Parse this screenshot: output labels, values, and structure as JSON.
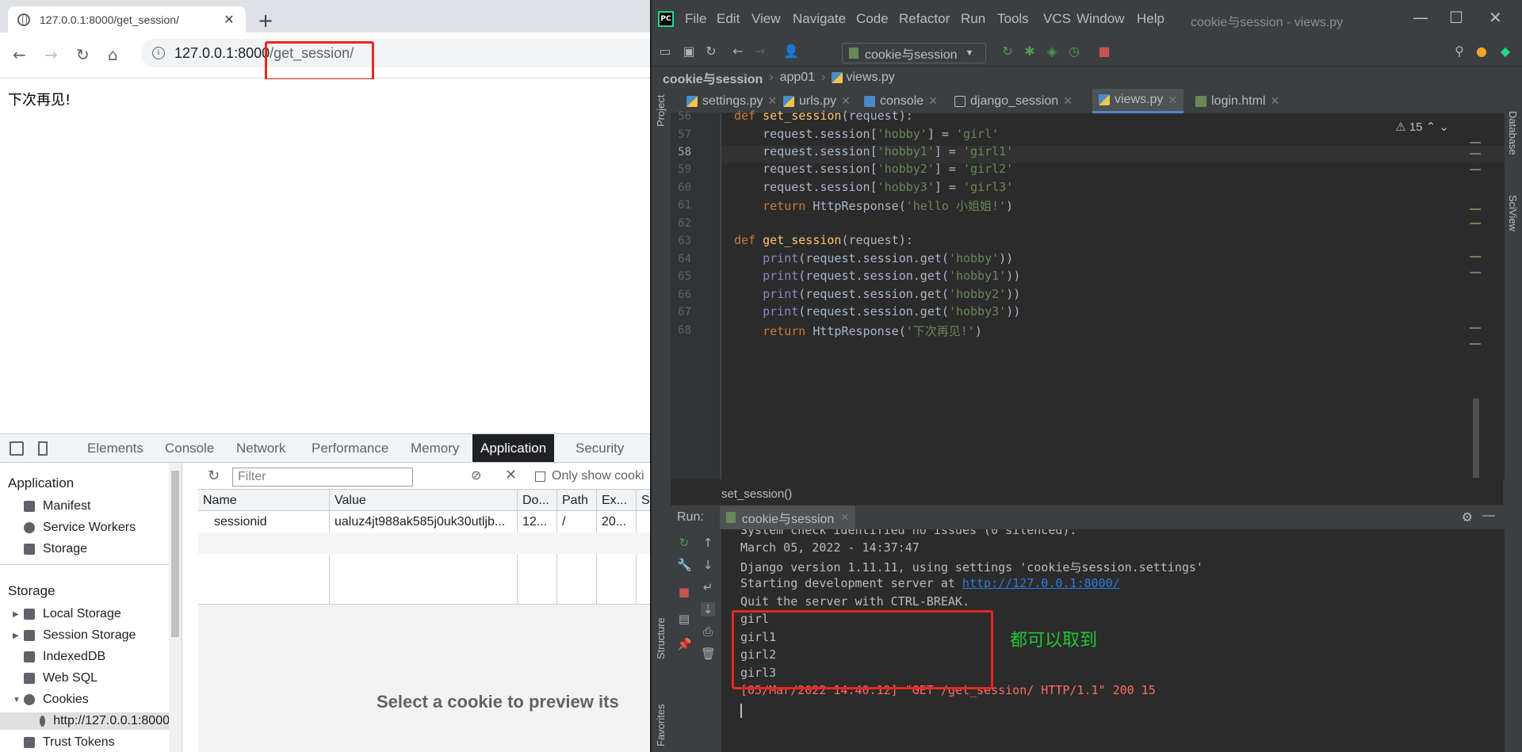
{
  "browser": {
    "tab_title": "127.0.0.1:8000/get_session/",
    "url_host": "127.0.0.1:8000",
    "url_path": "/get_session/",
    "page_text": "下次再见!"
  },
  "devtools": {
    "tabs": [
      "Elements",
      "Console",
      "Network",
      "Performance",
      "Memory",
      "Application",
      "Security"
    ],
    "active_tab": "Application",
    "sidebar": {
      "application_heading": "Application",
      "application_items": [
        "Manifest",
        "Service Workers",
        "Storage"
      ],
      "storage_heading": "Storage",
      "storage_items": [
        "Local Storage",
        "Session Storage",
        "IndexedDB",
        "Web SQL",
        "Cookies"
      ],
      "cookie_origin": "http://127.0.0.1:8000",
      "trust_tokens": "Trust Tokens"
    },
    "filter_placeholder": "Filter",
    "only_show_label": "Only show cooki",
    "table_headers": [
      "Name",
      "Value",
      "Do...",
      "Path",
      "Ex...",
      "Si"
    ],
    "table_rows": [
      [
        "sessionid",
        "ualuz4jt988ak585j0uk30utljb...",
        "12...",
        "/",
        "20...",
        ""
      ]
    ],
    "preview_text": "Select a cookie to preview its"
  },
  "pycharm": {
    "menu": [
      "File",
      "Edit",
      "View",
      "Navigate",
      "Code",
      "Refactor",
      "Run",
      "Tools",
      "VCS",
      "Window",
      "Help"
    ],
    "window_title": "cookie与session - views.py",
    "run_config": "cookie与session",
    "breadcrumbs": [
      "cookie与session",
      "app01",
      "views.py"
    ],
    "tabs": [
      "settings.py",
      "urls.py",
      "console",
      "django_session",
      "views.py",
      "login.html"
    ],
    "active_tab": "views.py",
    "warnings": "15",
    "code_lines": [
      {
        "n": "56",
        "text": "def set_session(request):"
      },
      {
        "n": "57",
        "text": "    request.session['hobby'] = 'girl'"
      },
      {
        "n": "58",
        "text": "    request.session['hobby1'] = 'girl1'"
      },
      {
        "n": "59",
        "text": "    request.session['hobby2'] = 'girl2'"
      },
      {
        "n": "60",
        "text": "    request.session['hobby3'] = 'girl3'"
      },
      {
        "n": "61",
        "text": "    return HttpResponse('hello 小姐姐!')"
      },
      {
        "n": "62",
        "text": ""
      },
      {
        "n": "63",
        "text": "def get_session(request):"
      },
      {
        "n": "64",
        "text": "    print(request.session.get('hobby'))"
      },
      {
        "n": "65",
        "text": "    print(request.session.get('hobby1'))"
      },
      {
        "n": "66",
        "text": "    print(request.session.get('hobby2'))"
      },
      {
        "n": "67",
        "text": "    print(request.session.get('hobby3'))"
      },
      {
        "n": "68",
        "text": "    return HttpResponse('下次再见!')"
      }
    ],
    "editor_footer": "set_session()",
    "run_label": "Run:",
    "run_tab": "cookie与session",
    "console": {
      "partial_top": "System check identified no issues (0 silenced).",
      "line1": "March 05, 2022 - 14:37:47",
      "line2": "Django version 1.11.11, using settings 'cookie与session.settings'",
      "line3_prefix": "Starting development server at ",
      "line3_link": "http://127.0.0.1:8000/",
      "line4": "Quit the server with CTRL-BREAK.",
      "outputs": [
        "girl",
        "girl1",
        "girl2",
        "girl3"
      ],
      "request_log": "[05/Mar/2022 14:40:12] \"GET /get_session/ HTTP/1.1\" 200 15"
    },
    "annotation": "都可以取到",
    "strips": {
      "left_top": "Project",
      "left_mid": "Structure",
      "left_bottom": "Favorites",
      "right_top": "Database",
      "right_mid": "SciView"
    }
  }
}
